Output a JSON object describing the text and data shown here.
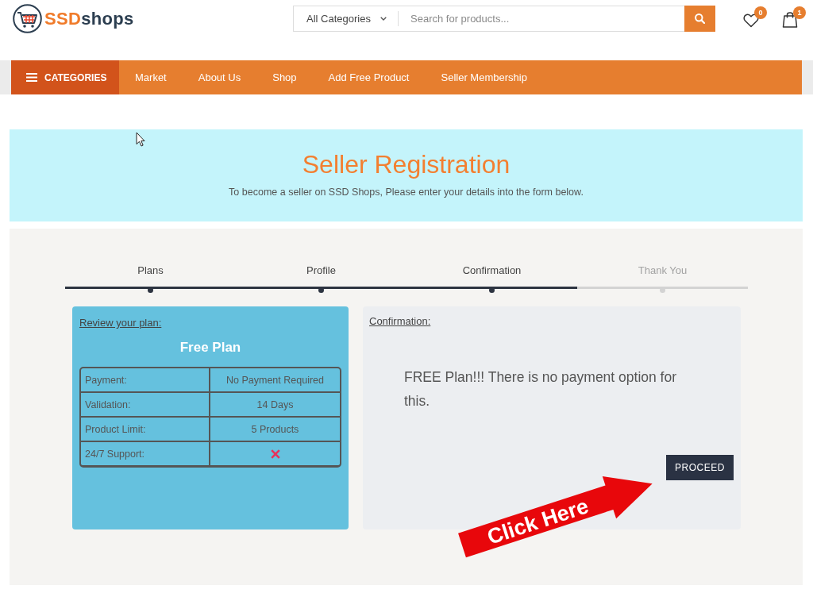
{
  "logo": {
    "accent": "SSD",
    "rest": "shops"
  },
  "search": {
    "category": "All Categories",
    "placeholder": "Search for products..."
  },
  "header_icons": [
    {
      "kind": "wishlist",
      "badge": "0"
    },
    {
      "kind": "cart",
      "badge": "1"
    }
  ],
  "nav": {
    "categories_label": "CATEGORIES",
    "items": [
      "Market",
      "About Us",
      "Shop",
      "Add Free Product",
      "Seller Membership"
    ]
  },
  "banner": {
    "title": "Seller Registration",
    "subtitle": "To become a seller on SSD Shops, Please enter your details into the form below."
  },
  "steps": [
    {
      "label": "Plans",
      "completed": true
    },
    {
      "label": "Profile",
      "completed": true
    },
    {
      "label": "Confirmation",
      "completed": true
    },
    {
      "label": "Thank You",
      "completed": false
    }
  ],
  "plan_card": {
    "heading": "Review your plan:",
    "plan_name": "Free Plan",
    "rows": [
      {
        "label": "Payment:",
        "kind": "text",
        "value": "No Payment Required"
      },
      {
        "label": "Validation:",
        "kind": "text",
        "value": "14 Days"
      },
      {
        "label": "Product Limit:",
        "kind": "text",
        "value": "5 Products"
      },
      {
        "label": "24/7 Support:",
        "kind": "cross"
      }
    ]
  },
  "confirmation_card": {
    "heading": "Confirmation:",
    "message": "FREE Plan!!! There is no payment option for this.",
    "button": "PROCEED"
  },
  "callout": {
    "text": "Click Here"
  }
}
